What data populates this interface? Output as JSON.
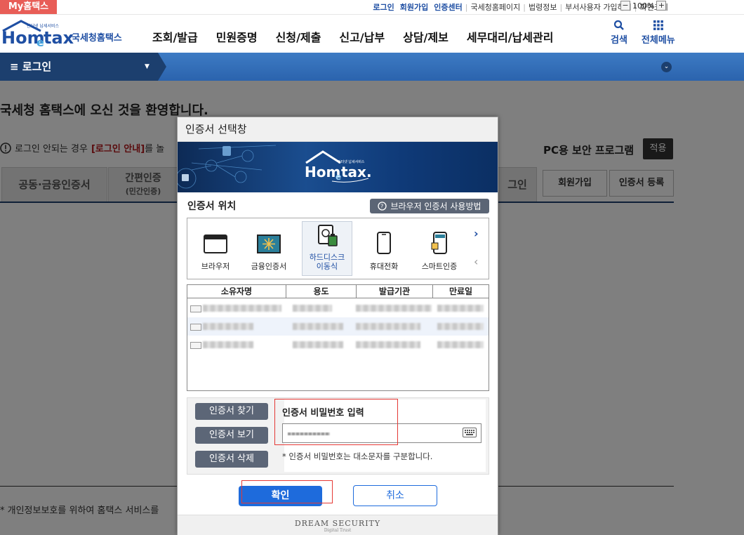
{
  "util": {
    "my_hometax": "My홈택스",
    "links": [
      "로그인",
      "회원가입",
      "인증센터"
    ],
    "plain_links": [
      "국세청홈페이지",
      "법령정보",
      "부서사용자 가입하기",
      "화면크기"
    ],
    "zoom": "100%",
    "zoom_minus": "−",
    "zoom_plus": "+"
  },
  "header": {
    "logo_text": "Hometax",
    "logo_caption": "국세청홈택스",
    "logo_small": "인터넷 납세서비스",
    "nav": [
      "조회/발급",
      "민원증명",
      "신청/제출",
      "신고/납부",
      "상담/제보",
      "세무대리/납세관리"
    ],
    "search_label": "검색",
    "allmenu_label": "전체메뉴"
  },
  "bar": {
    "login_label": "≡  로그인"
  },
  "page": {
    "welcome": "국세청 홈택스에 오신 것을 환영합니다.",
    "notice_prefix": "로그인 안되는 경우",
    "notice_link": "[로그인 안내]",
    "notice_suffix": "를 놀",
    "tab_cert": "공동·금융인증서",
    "tab_simple": "간편인증",
    "tab_simple_sub": "(민간인증)",
    "tab_right": "그인",
    "pc_security": "PC용 보안 프로그램",
    "apply": "적용",
    "signup": "회원가입",
    "cert_register": "인증서 등록",
    "privacy": "* 개인정보보호를 위하여 홈택스 서비스를 "
  },
  "modal": {
    "title": "인증서 선택창",
    "banner_small": "인터넷 납세서비스",
    "banner_logo": "Hometax.",
    "location_label": "인증서 위치",
    "help_button": "브라우저 인증서 사용방법",
    "locations": [
      {
        "label": "브라우저",
        "icon": "browser-icon"
      },
      {
        "label": "금융인증서",
        "icon": "financial-cert-icon"
      },
      {
        "label": "하드디스크\n이동식",
        "icon": "harddisk-icon",
        "selected": true
      },
      {
        "label": "휴대전화",
        "icon": "mobile-phone-icon"
      },
      {
        "label": "스마트인증",
        "icon": "smart-cert-icon"
      }
    ],
    "table_headers": [
      "소유자명",
      "용도",
      "발급기관",
      "만료일"
    ],
    "find_cert": "인증서 찾기",
    "view_cert": "인증서 보기",
    "delete_cert": "인증서 삭제",
    "password_label": "인증서 비밀번호 입력",
    "password_note": "* 인증서 비밀번호는 대소문자를 구분합니다.",
    "ok": "확인",
    "cancel": "취소",
    "footer": "DREAM SECURITY",
    "footer_sub": "Digital Trust"
  },
  "colors": {
    "accent": "#1e6bdc",
    "brand_dark": "#1c3f6e",
    "highlight_red": "#e53935",
    "my_hometax_bg": "#e85d57"
  }
}
